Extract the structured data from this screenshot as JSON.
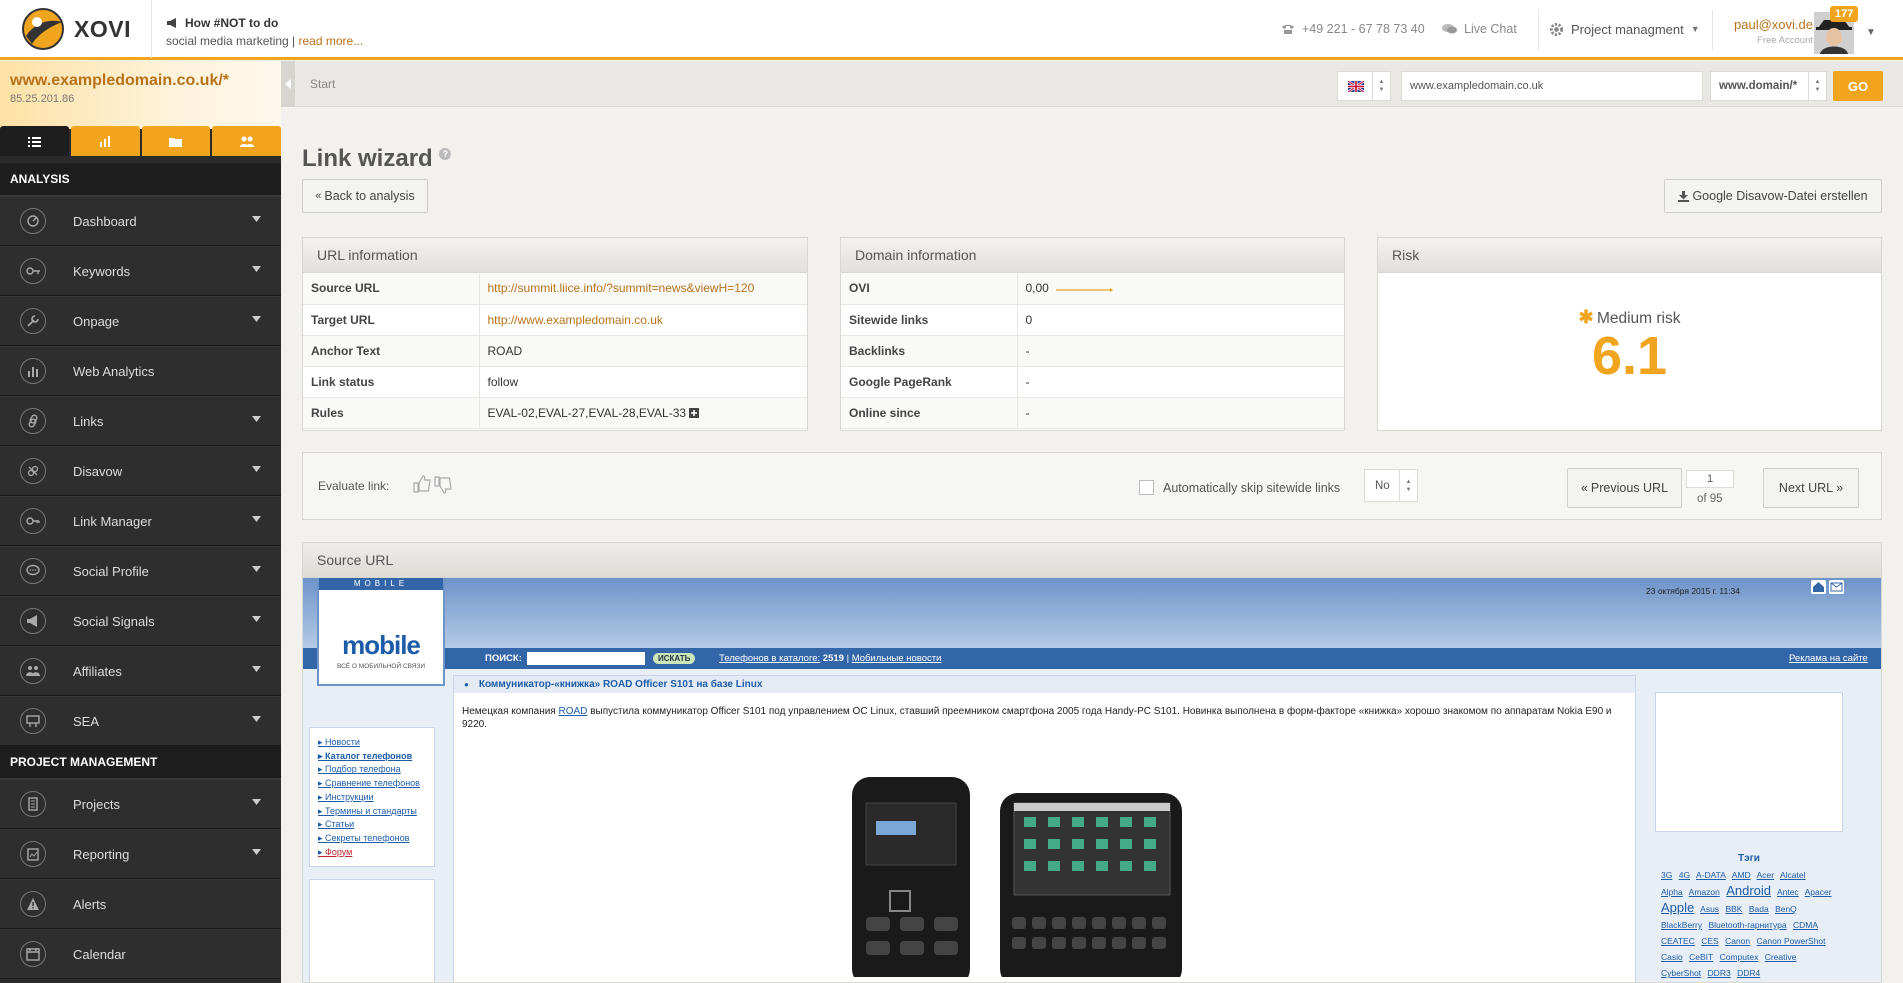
{
  "brand": {
    "name": "XOVI"
  },
  "news": {
    "title": "How #NOT to do",
    "text": "social media marketing |",
    "link": "read more..."
  },
  "topbar": {
    "phone": "+49 221 - 67 78 73 40",
    "chat": "Live Chat",
    "project": "Project managment"
  },
  "user": {
    "email": "paul@xovi.de",
    "account": "Free Account",
    "badge": "177"
  },
  "sidebar": {
    "domain": "www.exampledomain.co.uk/*",
    "ip": "85.25.201.86",
    "section_analysis": "ANALYSIS",
    "analysis_items": [
      {
        "label": "Dashboard",
        "icon": "dashboard-icon"
      },
      {
        "label": "Keywords",
        "icon": "key-icon"
      },
      {
        "label": "Onpage",
        "icon": "wrench-icon"
      },
      {
        "label": "Web Analytics",
        "icon": "bar-chart-icon"
      },
      {
        "label": "Links",
        "icon": "link-icon"
      },
      {
        "label": "Disavow",
        "icon": "unlink-icon"
      },
      {
        "label": "Link Manager",
        "icon": "key-link-icon"
      },
      {
        "label": "Social Profile",
        "icon": "chat-icon"
      },
      {
        "label": "Social Signals",
        "icon": "megaphone-icon"
      },
      {
        "label": "Affiliates",
        "icon": "people-icon"
      },
      {
        "label": "SEA",
        "icon": "billboard-icon"
      }
    ],
    "section_project": "PROJECT MANAGEMENT",
    "project_items": [
      {
        "label": "Projects",
        "icon": "document-icon"
      },
      {
        "label": "Reporting",
        "icon": "report-icon"
      },
      {
        "label": "Alerts",
        "icon": "warning-icon"
      },
      {
        "label": "Calendar",
        "icon": "calendar-icon"
      }
    ]
  },
  "crumb": {
    "start": "Start"
  },
  "search": {
    "url_value": "www.exampledomain.co.uk",
    "mode": "www.domain/*",
    "go": "GO"
  },
  "page": {
    "title": "Link wizard",
    "back": "Back to analysis",
    "disavow": "Google Disavow-Datei erstellen"
  },
  "url_info": {
    "title": "URL information",
    "rows": [
      {
        "k": "Source URL",
        "v": "http://summit.liice.info/?summit=news&viewH=120"
      },
      {
        "k": "Target URL",
        "v": "http://www.exampledomain.co.uk"
      },
      {
        "k": "Anchor Text",
        "v": "ROAD"
      },
      {
        "k": "Link status",
        "v": "follow"
      },
      {
        "k": "Rules",
        "v": "EVAL-02,EVAL-27,EVAL-28,EVAL-33"
      }
    ]
  },
  "domain_info": {
    "title": "Domain information",
    "rows": [
      {
        "k": "OVI",
        "v": "0,00"
      },
      {
        "k": "Sitewide links",
        "v": "0"
      },
      {
        "k": "Backlinks",
        "v": "-"
      },
      {
        "k": "Google PageRank",
        "v": "-"
      },
      {
        "k": "Online since",
        "v": "-"
      }
    ]
  },
  "risk": {
    "title": "Risk",
    "label": "Medium risk",
    "value": "6.1"
  },
  "evaluate": {
    "label": "Evaluate link:",
    "skip": "Automatically skip sitewide links",
    "skip_value": "No",
    "prev": "Previous URL",
    "next": "Next URL",
    "page": "1",
    "of": "of 95"
  },
  "source": {
    "title": "Source URL",
    "site": {
      "date": "23 октября 2015 г. 11:34",
      "logo_top": "MOBILE",
      "logo_word": "mobile",
      "logo_sub": "ВСЁ О МОБИЛЬНОЙ СВЯЗИ",
      "search_label": "ПОИСК:",
      "search_btn": "ИСКАТЬ",
      "catalog": "Телефонов в каталоге:",
      "catalog_count": "2519",
      "mobile_news": "Мобильные новости",
      "ads": "Реклама на сайте",
      "menu": [
        "Новости",
        "Каталог телефонов",
        "Подбор телефона",
        "Сравнение телефонов",
        "Инструкции",
        "Термины и стандарты",
        "Статьи",
        "Секреты телефонов",
        "Форум"
      ],
      "article_title": "Коммуникатор-«книжка» ROAD Officer S101 на базе Linux",
      "article_pre": "Немецкая компания",
      "article_link": "ROAD",
      "article_text": "выпустила коммуникатор Officer S101 под управлением ОС Linux, ставший преемником смартфона 2005 года Handy-PC S101. Новинка выполнена в форм-факторе «книжка» хорошо знакомом по аппаратам Nokia E90 и 9220.",
      "tags_title": "Тэги",
      "tags": [
        "3G",
        "4G",
        "A-DATA",
        "AMD",
        "Acer",
        "Alcatel",
        "Alpha",
        "Amazon",
        "Android",
        "Antec",
        "Apacer",
        "Apple",
        "Asus",
        "BBK",
        "Bada",
        "BenQ",
        "BlackBerry",
        "Bluetooth-гарнитура",
        "CDMA",
        "CEATEC",
        "CES",
        "Canon",
        "Canon PowerShot",
        "Casio",
        "CeBIT",
        "Computex",
        "Creative",
        "CyberShot",
        "DDR3",
        "DDR4"
      ]
    }
  },
  "colors": {
    "accent": "#f1a51e",
    "sidebar": "#2b2b2b",
    "link": "#b8731a"
  }
}
